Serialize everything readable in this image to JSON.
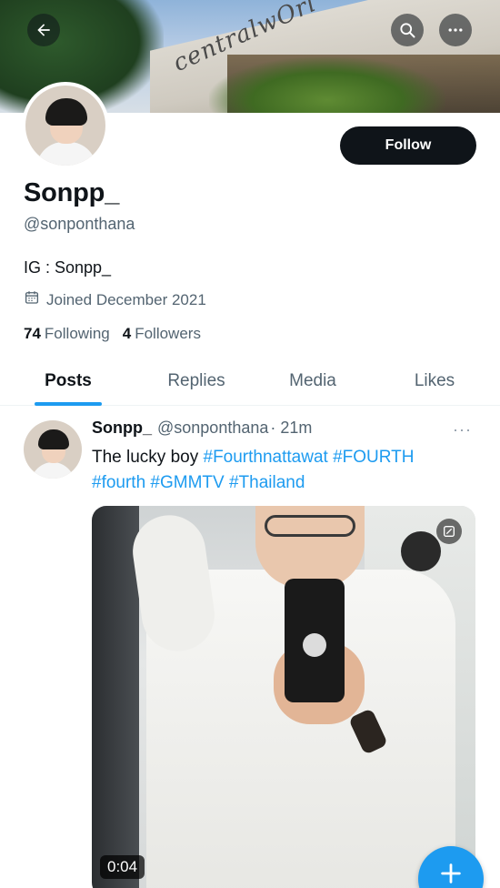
{
  "header": {
    "back_icon": "arrow-left-icon",
    "search_icon": "search-icon",
    "more_icon": "more-horizontal-icon",
    "banner_text": "centralwOrl"
  },
  "profile": {
    "display_name": "Sonpp_",
    "handle": "@sonponthana",
    "bio": "IG : Sonpp_",
    "joined": "Joined December 2021",
    "following_count": "74",
    "following_label": "Following",
    "followers_count": "4",
    "followers_label": "Followers",
    "follow_button": "Follow"
  },
  "tabs": [
    {
      "label": "Posts",
      "active": true
    },
    {
      "label": "Replies",
      "active": false
    },
    {
      "label": "Media",
      "active": false
    },
    {
      "label": "Likes",
      "active": false
    }
  ],
  "tweet": {
    "name": "Sonpp_",
    "handle": "@sonponthana",
    "time": "· 21m",
    "text_plain": "The lucky boy ",
    "hashtags_line1": "#Fourthnattawat #FOURTH",
    "hashtags_line2": "#fourth #GMMTV #Thailand",
    "more": "···",
    "video_duration": "0:04"
  },
  "colors": {
    "accent": "#1d9bf0",
    "text_primary": "#0f1419",
    "text_secondary": "#536471"
  }
}
